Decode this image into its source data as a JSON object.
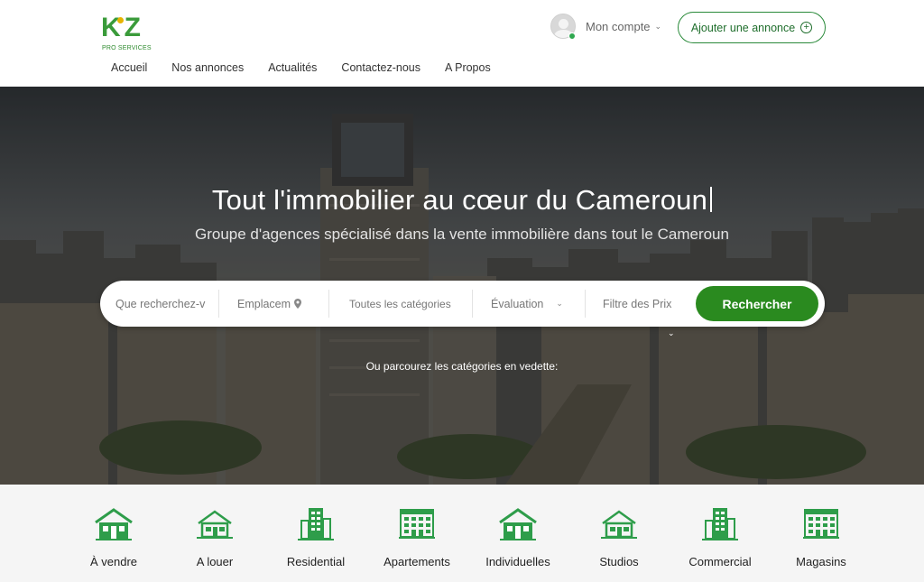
{
  "brand": {
    "logo_text": "KiZ",
    "logo_sub": "PRO SERVICES"
  },
  "nav": {
    "items": [
      {
        "label": "Accueil"
      },
      {
        "label": "Nos annonces"
      },
      {
        "label": "Actualités"
      },
      {
        "label": "Contactez-nous"
      },
      {
        "label": "A Propos"
      }
    ]
  },
  "header": {
    "account_label": "Mon compte",
    "account_chevron": "chevron-down-icon",
    "add_button_label": "Ajouter une annonce",
    "add_icon": "plus-circle-icon"
  },
  "hero": {
    "title": "Tout l'immobilier au cœur du Cameroun",
    "subtitle": "Groupe d'agences spécialisé dans la vente immobilière dans tout le Cameroun",
    "browse_text": "Ou parcourez les catégories en vedette:"
  },
  "search": {
    "keyword_placeholder": "Que recherchez-v",
    "location_placeholder": "Emplacem",
    "category_value": "Toutes les catégories",
    "rating_value": "Évaluation",
    "price_placeholder": "Filtre des Prix",
    "button_label": "Rechercher"
  },
  "categories": [
    {
      "label": "À vendre",
      "icon": "house-icon"
    },
    {
      "label": "A louer",
      "icon": "house-outline-icon"
    },
    {
      "label": "Residential",
      "icon": "building-icon"
    },
    {
      "label": "Apartements",
      "icon": "apartment-icon"
    },
    {
      "label": "Individuelles",
      "icon": "house-icon"
    },
    {
      "label": "Studios",
      "icon": "house-outline-icon"
    },
    {
      "label": "Commercial",
      "icon": "building-icon"
    },
    {
      "label": "Magasins",
      "icon": "apartment-icon"
    }
  ],
  "colors": {
    "brand_green": "#2a8a1f",
    "icon_green": "#2e9d4a",
    "accent_yellow": "#e8b400"
  }
}
